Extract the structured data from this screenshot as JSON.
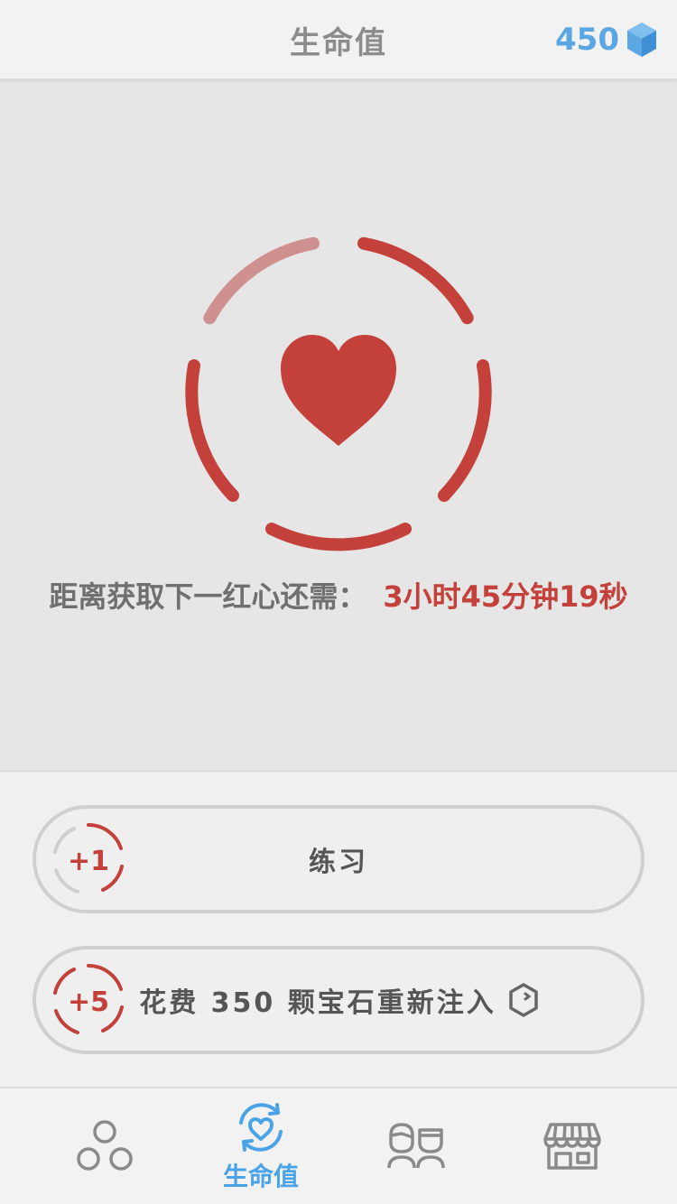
{
  "header": {
    "title": "生命值",
    "gems": "450",
    "gem_icon": "gem-icon",
    "accent_color": "#5aa7e3"
  },
  "hearts": {
    "icon": "heart-icon",
    "countdown_label": "距离获取下一红心还需：",
    "countdown_value": "3小时45分钟19秒",
    "accent_color": "#c4403a",
    "segments_total": 5,
    "segments_filled": 4
  },
  "actions": [
    {
      "badge": "+1",
      "label": "练习",
      "badge_style": "muted"
    },
    {
      "badge": "+5",
      "label": "花费 350 颗宝石重新注入",
      "badge_style": "red",
      "icon": "gem-outline-icon"
    }
  ],
  "tabs": [
    {
      "name": "learn",
      "icon": "circles-icon",
      "label": ""
    },
    {
      "name": "hearts",
      "icon": "heart-refresh-icon",
      "label": "生命值",
      "active": true
    },
    {
      "name": "profile",
      "icon": "people-icon",
      "label": ""
    },
    {
      "name": "shop",
      "icon": "shop-icon",
      "label": ""
    }
  ]
}
